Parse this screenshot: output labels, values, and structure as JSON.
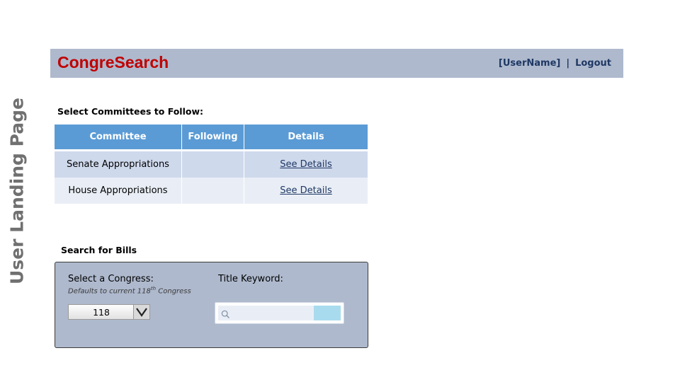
{
  "page": {
    "side_title": "User Landing Page"
  },
  "header": {
    "brand": "CongreSearch",
    "username": "[UserName]",
    "separator": "|",
    "logout_label": "Logout"
  },
  "committees": {
    "section_title": "Select Committees to Follow:",
    "columns": [
      "Committee",
      "Following",
      "Details"
    ],
    "rows": [
      {
        "committee": "Senate Appropriations",
        "following": "",
        "details_link": "See Details"
      },
      {
        "committee": "House Appropriations",
        "following": "",
        "details_link": "See Details"
      }
    ]
  },
  "bill_search": {
    "section_title": "Search for Bills",
    "congress_label": "Select a Congress:",
    "congress_hint_prefix": "Defaults to current 118",
    "congress_hint_sup": "th",
    "congress_hint_suffix": " Congress",
    "congress_value": "118",
    "keyword_label": "Title Keyword:",
    "keyword_value": "",
    "icons": {
      "dropdown": "chevron-down-icon",
      "search": "search-icon"
    }
  },
  "colors": {
    "brand": "#c00000",
    "header_bg": "#aeb9cd",
    "table_header": "#5b9bd5",
    "row_odd": "#cfd9ec",
    "row_even": "#e9eef6",
    "search_button": "#a9dbee"
  }
}
